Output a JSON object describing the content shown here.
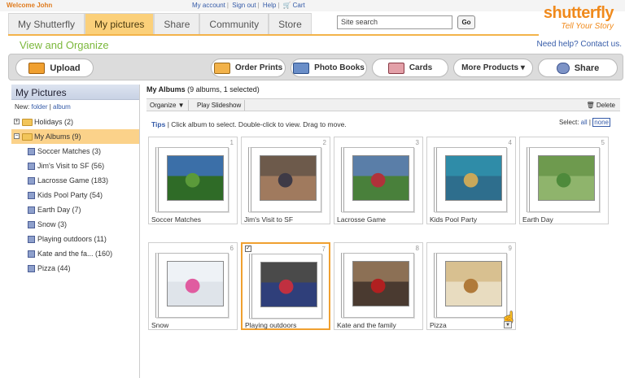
{
  "topbar": {
    "welcome": "Welcome John",
    "links": [
      "My account",
      "Sign out",
      "Help",
      "Cart"
    ]
  },
  "logo": {
    "name": "shutterfly",
    "tagline": "Tell Your Story"
  },
  "nav": {
    "tabs": [
      "My Shutterfly",
      "My pictures",
      "Share",
      "Community",
      "Store"
    ],
    "active": "My pictures"
  },
  "search": {
    "value": "Site search",
    "go_label": "Go"
  },
  "page": {
    "title": "View and Organize",
    "help": "Need help? Contact us."
  },
  "toolbar": {
    "upload": "Upload",
    "order_prints": "Order Prints",
    "photo_books": "Photo Books",
    "cards": "Cards",
    "more_products": "More Products ▾",
    "share": "Share"
  },
  "sidebar": {
    "heading": "My Pictures",
    "new_label": "New:",
    "new_folder": "folder",
    "new_album": "album",
    "folders": [
      {
        "label": "Holidays (2)",
        "expander": "+"
      },
      {
        "label": "My Albums (9)",
        "expander": "−"
      }
    ],
    "albums": [
      "Soccer Matches (3)",
      "Jim's Visit to SF (56)",
      "Lacrosse Game (183)",
      "Kids Pool Party (54)",
      "Earth Day (7)",
      "Snow (3)",
      "Playing outdoors (11)",
      "Kate and the fa... (160)",
      "Pizza (44)"
    ]
  },
  "main": {
    "title_bold": "My Albums",
    "title_rest": " (9 albums, 1 selected)",
    "organize": "Organize ▼",
    "slideshow": "Play Slideshow",
    "delete": "Delete",
    "tips_label": "Tips",
    "tips_text": " | Click album to select. Double-click to view. Drag to move.",
    "select_label": "Select:",
    "select_all": "all",
    "select_none": "none",
    "albums": [
      {
        "num": "1",
        "caption": "Soccer Matches",
        "colors": [
          "#3b6fa8",
          "#5b9a3a",
          "#2f6b27"
        ]
      },
      {
        "num": "2",
        "caption": "Jim's Visit to SF",
        "colors": [
          "#6d5a4b",
          "#3e3a46",
          "#a07a5e"
        ]
      },
      {
        "num": "3",
        "caption": "Lacrosse Game",
        "colors": [
          "#5a7ea8",
          "#b0323a",
          "#49803b"
        ]
      },
      {
        "num": "4",
        "caption": "Kids Pool Party",
        "colors": [
          "#2f8ca8",
          "#c9a85a",
          "#2e6e8d"
        ]
      },
      {
        "num": "5",
        "caption": "Earth Day",
        "colors": [
          "#6e9a4e",
          "#4e8a3b",
          "#8fb46c"
        ]
      },
      {
        "num": "6",
        "caption": "Snow",
        "colors": [
          "#eef2f6",
          "#e05ca0",
          "#dfe4ea"
        ]
      },
      {
        "num": "7",
        "caption": "Playing outdoors",
        "colors": [
          "#4a4a4a",
          "#c03040",
          "#2f3f7a"
        ]
      },
      {
        "num": "8",
        "caption": "Kate and the family",
        "colors": [
          "#8c7055",
          "#b02020",
          "#4a3a30"
        ]
      },
      {
        "num": "9",
        "caption": "Pizza",
        "colors": [
          "#d8c090",
          "#b07a3a",
          "#e8dcc0"
        ]
      }
    ]
  }
}
